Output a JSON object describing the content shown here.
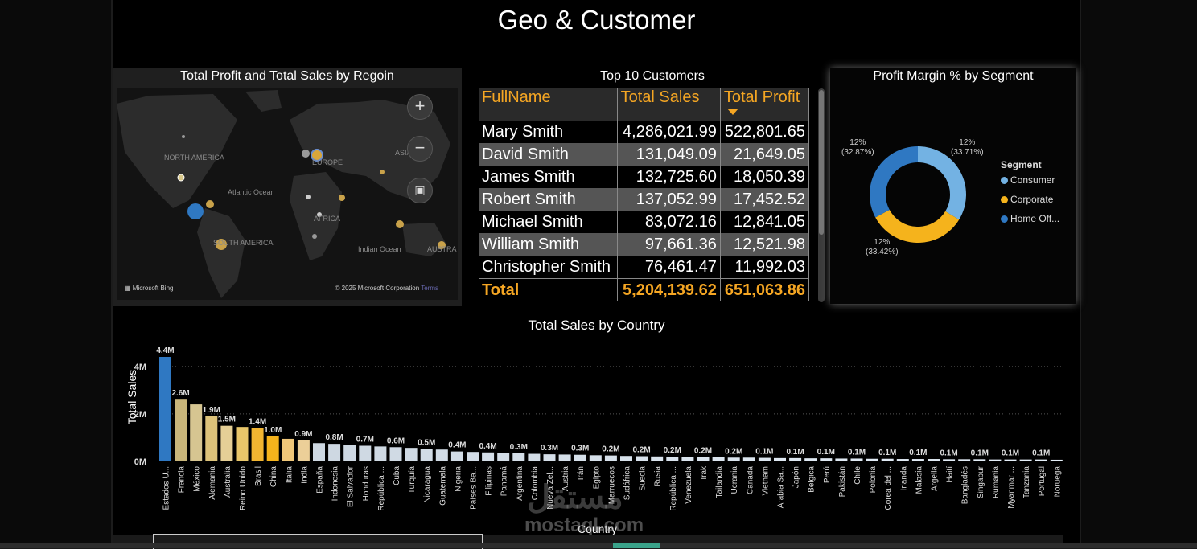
{
  "page": {
    "title": "Geo & Customer"
  },
  "map": {
    "title": "Total Profit and Total Sales by Regoin",
    "labels": [
      "NORTH AMERICA",
      "Atlantic Ocean",
      "SOUTH AMERICA",
      "EUROPE",
      "AFRICA",
      "ASIA",
      "Indian Ocean",
      "AUSTRA"
    ],
    "zoom_in": "+",
    "zoom_out": "−",
    "attribution": "Microsoft Bing",
    "copyright": "© 2025 Microsoft Corporation",
    "terms": "Terms"
  },
  "customers": {
    "title": "Top 10 Customers",
    "headers": [
      "FullName",
      "Total Sales",
      "Total Profit"
    ],
    "rows": [
      [
        "Mary Smith",
        "4,286,021.99",
        "522,801.65"
      ],
      [
        "David Smith",
        "131,049.09",
        "21,649.05"
      ],
      [
        "James Smith",
        "132,725.60",
        "18,050.39"
      ],
      [
        "Robert Smith",
        "137,052.99",
        "17,452.52"
      ],
      [
        "Michael Smith",
        "83,072.16",
        "12,841.05"
      ],
      [
        "William Smith",
        "97,661.36",
        "12,521.98"
      ],
      [
        "Christopher Smith",
        "76,461.47",
        "11,992.03"
      ]
    ],
    "total": [
      "Total",
      "5,204,139.62",
      "651,063.86"
    ]
  },
  "segment": {
    "title": "Profit Margin % by Segment",
    "legend_title": "Segment",
    "labels": [
      {
        "pct": "12%",
        "share": "(33.71%)"
      },
      {
        "pct": "12%",
        "share": "(33.42%)"
      },
      {
        "pct": "12%",
        "share": "(32.87%)"
      }
    ],
    "chart_data": {
      "type": "pie",
      "categories": [
        "Consumer",
        "Corporate",
        "Home Off..."
      ],
      "values": [
        33.71,
        33.42,
        32.87
      ],
      "colors": [
        "#73b2e3",
        "#f5b31c",
        "#2f78c2"
      ]
    }
  },
  "sales": {
    "title": "Total Sales by Country",
    "ylabel": "Total Sales",
    "xlabel": "Country",
    "yticks": [
      "0M",
      "2M",
      "4M"
    ],
    "chart_data": {
      "type": "bar",
      "title": "Total Sales by Country",
      "xlabel": "Country",
      "ylabel": "Total Sales",
      "ylim": [
        0,
        4.4
      ],
      "categories": [
        "Estados U...",
        "Francia",
        "México",
        "Alemania",
        "Australia",
        "Reino Unido",
        "Brasil",
        "China",
        "Italia",
        "India",
        "España",
        "Indonesia",
        "El Salvador",
        "Honduras",
        "República ...",
        "Cuba",
        "Turquía",
        "Nicaragua",
        "Guatemala",
        "Nigeria",
        "Países Ba...",
        "Filipinas",
        "Panamá",
        "Argentina",
        "Colombia",
        "Nueva Zel...",
        "Austria",
        "Irán",
        "Egipto",
        "Marruecos",
        "Sudáfrica",
        "Suecia",
        "Rusia",
        "República ...",
        "Venezuela",
        "Irak",
        "Tailandia",
        "Ucrania",
        "Canadá",
        "Vietnam",
        "Arabia Sa...",
        "Japón",
        "Bélgica",
        "Perú",
        "Pakistán",
        "Chile",
        "Polonia",
        "Corea del ...",
        "Irlanda",
        "Malasia",
        "Argelia",
        "Haití",
        "Bangladés",
        "Singapur",
        "Rumania",
        "Myanmar ...",
        "Tanzania",
        "Portugal",
        "Noruega"
      ],
      "values": [
        4.4,
        2.6,
        2.4,
        1.9,
        1.5,
        1.45,
        1.4,
        1.05,
        0.95,
        0.88,
        0.77,
        0.74,
        0.7,
        0.66,
        0.63,
        0.6,
        0.57,
        0.52,
        0.5,
        0.42,
        0.4,
        0.38,
        0.36,
        0.34,
        0.32,
        0.3,
        0.29,
        0.28,
        0.26,
        0.25,
        0.23,
        0.22,
        0.21,
        0.2,
        0.19,
        0.18,
        0.17,
        0.16,
        0.16,
        0.15,
        0.14,
        0.14,
        0.13,
        0.13,
        0.12,
        0.12,
        0.11,
        0.11,
        0.1,
        0.1,
        0.1,
        0.09,
        0.09,
        0.09,
        0.08,
        0.08,
        0.08,
        0.08,
        0.07
      ],
      "data_labels": [
        "4.4M",
        "2.6M",
        "",
        "1.9M",
        "1.5M",
        "",
        "1.4M",
        "1.0M",
        "",
        "0.9M",
        "",
        "0.8M",
        "",
        "0.7M",
        "",
        "0.6M",
        "",
        "0.5M",
        "",
        "0.4M",
        "",
        "0.4M",
        "",
        "0.3M",
        "",
        "0.3M",
        "",
        "0.3M",
        "",
        "0.2M",
        "",
        "0.2M",
        "",
        "0.2M",
        "",
        "0.2M",
        "",
        "0.2M",
        "",
        "0.1M",
        "",
        "0.1M",
        "",
        "0.1M",
        "",
        "0.1M",
        "",
        "0.1M",
        "",
        "0.1M",
        "",
        "0.1M",
        "",
        "0.1M",
        "",
        "0.1M",
        "",
        "0.1M",
        ""
      ]
    }
  }
}
